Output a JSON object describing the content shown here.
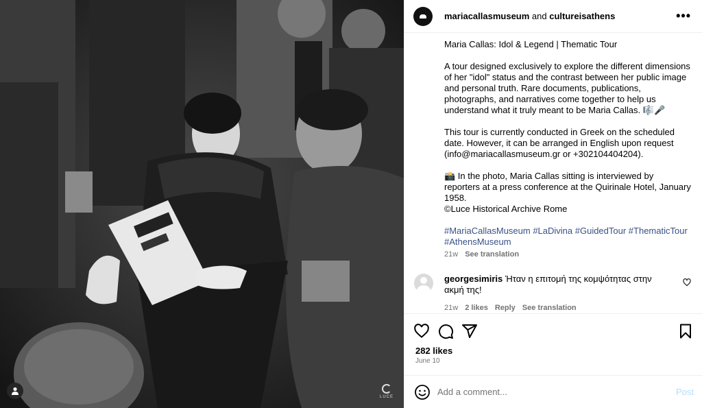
{
  "header": {
    "account": "mariacallasmuseum",
    "joiner": "and",
    "collaborator": "cultureisathens",
    "more_icon": "more-horizontal-icon"
  },
  "caption": {
    "title": "Maria Callas: Idol & Legend | Thematic Tour",
    "paragraph1": "A tour designed exclusively to explore the different dimensions of her \"idol\" status and the contrast between her public image and personal truth. Rare documents, publications, photographs, and narratives come together to help us understand what it truly meant to be Maria Callas. 🎼🎤",
    "paragraph2": "This tour is currently conducted in Greek on the scheduled date. However, it can be arranged in English upon request (info@mariacallasmuseum.gr or +302104404204).",
    "paragraph3": "📸 In the photo, Maria Callas sitting is interviewed by reporters at a press conference at the Quirinale Hotel, January 1958.\n©Luce Historical Archive Rome",
    "hashtags": "#MariaCallasMuseum #LaDivina #GuidedTour #ThematicTour #AthensMuseum",
    "age": "21w",
    "see_translation": "See translation"
  },
  "comment": {
    "user": "georgesimiris",
    "text": "Ήταν η επιτομή της κομψότητας στην ακμή της!",
    "age": "21w",
    "likes": "2 likes",
    "reply": "Reply",
    "see_translation": "See translation"
  },
  "actions": {
    "likes": "282 likes",
    "date": "June 10"
  },
  "add_comment": {
    "placeholder": "Add a comment...",
    "post": "Post"
  },
  "photo": {
    "watermark": "LUCE"
  }
}
